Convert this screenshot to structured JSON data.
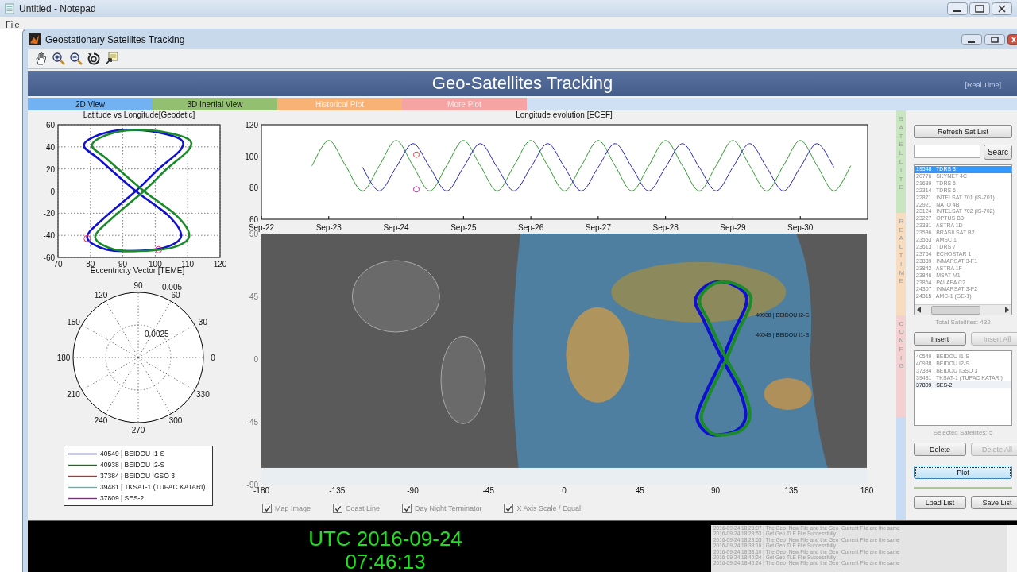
{
  "notepad": {
    "title": "Untitled - Notepad",
    "menu": [
      "File"
    ]
  },
  "window": {
    "title": "Geostationary Satellites Tracking"
  },
  "header": {
    "title": "Geo-Satellites Tracking",
    "mode": "[Real Time]"
  },
  "tabs": [
    {
      "label": "2D View",
      "color": "#72b2f2",
      "disabled": false
    },
    {
      "label": "3D Inertial View",
      "color": "#93c070",
      "disabled": false
    },
    {
      "label": "Historical Plot",
      "color": "#f9b275",
      "disabled": true
    },
    {
      "label": "More Plot",
      "color": "#f6a3a3",
      "disabled": true
    }
  ],
  "lat_lon_plot": {
    "title": "Latitude vs Longitude[Geodetic]",
    "x_ticks": [
      "70",
      "80",
      "90",
      "100",
      "110",
      "120"
    ],
    "y_ticks": [
      "60",
      "40",
      "20",
      "0",
      "-20",
      "-40",
      "-60"
    ]
  },
  "polar_plot": {
    "title": "Eccentricity Vector [TEME]",
    "angle_labels": [
      "0",
      "30",
      "60",
      "90",
      "120",
      "150",
      "180",
      "210",
      "240",
      "270",
      "300",
      "330"
    ],
    "radius_labels": [
      "0.0025",
      "0.005"
    ]
  },
  "legend": [
    {
      "label": "40549 | BEIDOU I1-S",
      "color": "#000080"
    },
    {
      "label": "40938 | BEIDOU I2-S",
      "color": "#008000"
    },
    {
      "label": "37384 | BEIDOU IGSO 3",
      "color": "#e02020"
    },
    {
      "label": "39481 | TKSAT-1 (TUPAC KATARI)",
      "color": "#40c0c0"
    },
    {
      "label": "37809 | SES-2",
      "color": "#c000c0"
    }
  ],
  "longitude_plot": {
    "chart_data": {
      "type": "line",
      "title": "Longitude evolution [ECEF]",
      "ylim": [
        60,
        120
      ],
      "yticks": [
        60,
        80,
        100,
        120
      ],
      "categories": [
        "Sep-22",
        null,
        null,
        null,
        "Sep-23",
        null,
        null,
        null,
        "Sep-24",
        null,
        null,
        null,
        "Sep-25",
        null,
        null,
        null,
        "Sep-26",
        null,
        null,
        null,
        "Sep-27",
        null,
        null,
        null,
        "Sep-28",
        null,
        null,
        null,
        "Sep-29",
        null,
        null,
        null,
        "Sep-30",
        null,
        null,
        null
      ],
      "series": [
        {
          "color": "#2a9a2a",
          "values": [
            null,
            null,
            null,
            94,
            110,
            94,
            78,
            94,
            110,
            94,
            78,
            94,
            110,
            94,
            78,
            94,
            110,
            94,
            78,
            94,
            110,
            94,
            78,
            94,
            110,
            94,
            78,
            94,
            110,
            94,
            78,
            94,
            110,
            94,
            78,
            94
          ]
        },
        {
          "color": "#2020c0",
          "values": [
            null,
            null,
            null,
            null,
            null,
            null,
            93,
            78,
            93,
            108,
            93,
            78,
            93,
            108,
            93,
            78,
            93,
            108,
            93,
            78,
            93,
            108,
            93,
            78,
            93,
            108,
            93,
            78,
            93,
            108,
            93,
            78,
            93,
            108,
            93,
            null
          ]
        }
      ]
    }
  },
  "map": {
    "x_ticks": [
      "-180",
      "-135",
      "-90",
      "-45",
      "0",
      "45",
      "90",
      "135",
      "180"
    ],
    "y_ticks": [
      "90",
      "45",
      "0",
      "-45",
      "-90"
    ],
    "satellite_labels": [
      "40938 | BEIDOU I2-S",
      "40549 | BEIDOU I1-S"
    ]
  },
  "map_options": [
    {
      "label": "Map Image",
      "checked": true
    },
    {
      "label": "Coast Line",
      "checked": true
    },
    {
      "label": "Day Night Terminator",
      "checked": true
    },
    {
      "label": "X Axis Scale / Equal",
      "checked": true
    }
  ],
  "side_tabs": [
    {
      "label": "SATELLITE",
      "color": "#c8e6c0"
    },
    {
      "label": "REAL TIME",
      "color": "#f8dcc0"
    },
    {
      "label": "CONFIG",
      "color": "#f4d0d0"
    },
    {
      "color": "#c8dcf4"
    }
  ],
  "refresh_button": {
    "label": "Refresh Sat List",
    "disabled": false,
    "focused": false
  },
  "search": {
    "button": {
      "label": "Searc",
      "disabled": false,
      "focused": false
    }
  },
  "satellite_list": {
    "items": [
      {
        "text": "19548 | TDRS 3",
        "selected": true
      },
      {
        "text": "20776 | SKYNET 4C",
        "selected": false
      },
      {
        "text": "21639 | TDRS 5",
        "selected": false
      },
      {
        "text": "22314 | TDRS 6",
        "selected": false
      },
      {
        "text": "22871 | INTELSAT 701 (IS-701)",
        "selected": false
      },
      {
        "text": "22921 | NATO 4B",
        "selected": false
      },
      {
        "text": "23124 | INTELSAT 702 (IS-702)",
        "selected": false
      },
      {
        "text": "23227 | OPTUS B3",
        "selected": false
      },
      {
        "text": "23331 | ASTRA 1D",
        "selected": false
      },
      {
        "text": "23536 | BRASILSAT B2",
        "selected": false
      },
      {
        "text": "23553 | AMSC 1",
        "selected": false
      },
      {
        "text": "23613 | TDRS 7",
        "selected": false
      },
      {
        "text": "23754 | ECHOSTAR 1",
        "selected": false
      },
      {
        "text": "23839 | INMARSAT 3-F1",
        "selected": false
      },
      {
        "text": "23842 | ASTRA 1F",
        "selected": false
      },
      {
        "text": "23846 | MSAT M1",
        "selected": false
      },
      {
        "text": "23864 | PALAPA C2",
        "selected": false
      },
      {
        "text": "24307 | INMARSAT 3-F2",
        "selected": false
      },
      {
        "text": "24315 | AMC-1 (GE-1)",
        "selected": false
      }
    ],
    "total": "Total Satellites: 432"
  },
  "insert_buttons": [
    {
      "label": "Insert",
      "disabled": false,
      "focused": false
    },
    {
      "label": "Insert All",
      "disabled": true,
      "focused": false
    }
  ],
  "selected_list": {
    "items": [
      {
        "text": "40549 | BEIDOU I1-S",
        "selected": false
      },
      {
        "text": "40938 | BEIDOU I2-S",
        "selected": false
      },
      {
        "text": "37384 | BEIDOU IGSO 3",
        "selected": false
      },
      {
        "text": "39481 | TKSAT-1 (TUPAC KATARI)",
        "selected": false
      },
      {
        "text": "37809 | SES-2",
        "selected": true
      }
    ],
    "total": "Selected Satellites: 5"
  },
  "delete_buttons": [
    {
      "label": "Delete",
      "disabled": false,
      "focused": false
    },
    {
      "label": "Delete All",
      "disabled": true,
      "focused": false
    }
  ],
  "plot_button": {
    "label": "Plot",
    "disabled": false,
    "focused": true
  },
  "list_buttons": [
    {
      "label": "Load List",
      "disabled": false,
      "focused": false
    },
    {
      "label": "Save List",
      "disabled": false,
      "focused": false
    }
  ],
  "clock": {
    "date": "UTC 2016-09-24",
    "time": "07:46:13"
  },
  "log": [
    "2016-09-24 18:28:07 | The Geo_New File and the Geo_Current File are the same",
    "2016-09-24 18:28:53 | Get Geo TLE File Successfully",
    "2016-09-24 18:28:53 | The Geo_New File and the Geo_Current File are the same",
    "2016-09-24 18:38:10 | Get Geo TLE File Successfully",
    "2016-09-24 18:38:10 | The Geo_New File and the Geo_Current File are the same",
    "2016-09-24 18:40:24 | Get Geo TLE File Successfully",
    "2016-09-24 18:40:24 | The Geo_New File and the Geo_Current File are the same"
  ]
}
